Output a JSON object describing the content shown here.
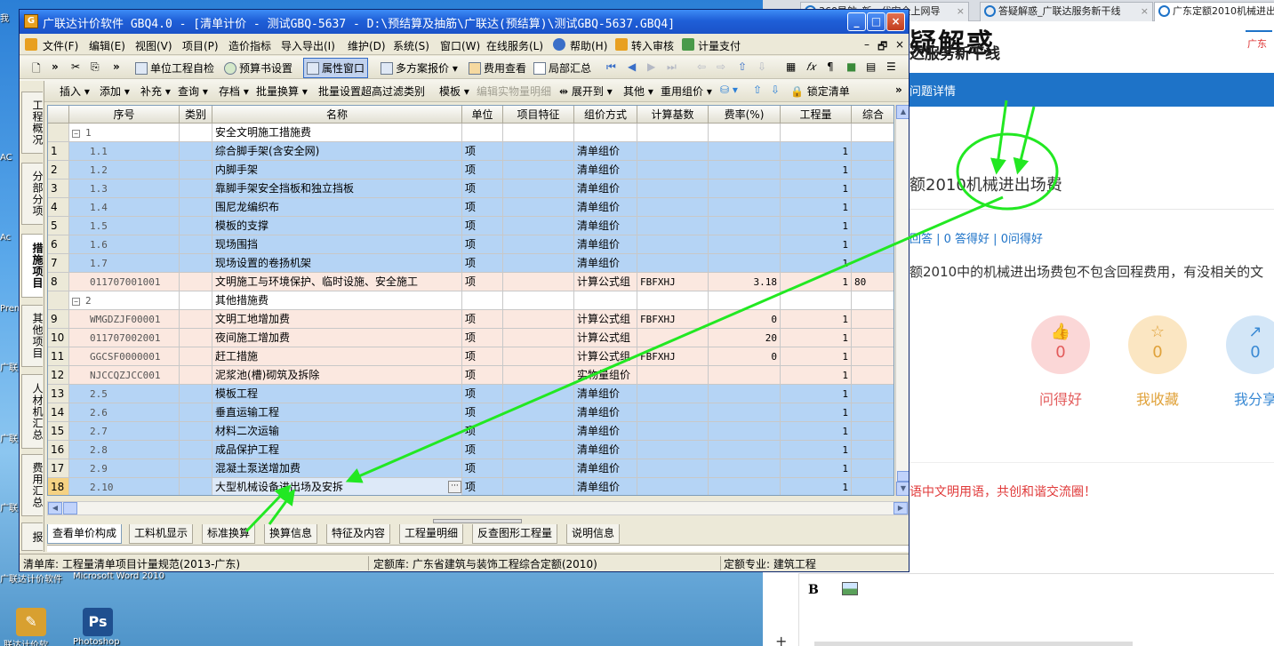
{
  "window": {
    "title": "广联达计价软件 GBQ4.0 - [清单计价 - 测试GBQ-5637 - D:\\预结算及抽筋\\广联达(预结算)\\测试GBQ-5637.GBQ4]",
    "minimize": "_",
    "maximize": "□",
    "close": "×"
  },
  "menu": {
    "items": [
      "文件(F)",
      "编辑(E)",
      "视图(V)",
      "项目(P)",
      "造价指标",
      "导入导出(I)",
      "维护(D)",
      "系统(S)",
      "窗口(W)",
      "在线服务(L)",
      "帮助(H)",
      "转入审核",
      "计量支付"
    ],
    "doc_controls": [
      "–",
      "🗗",
      "×"
    ]
  },
  "toolbar1": {
    "items": [
      "单位工程自检",
      "预算书设置",
      "属性窗口",
      "多方案报价 ▾",
      "费用查看",
      "局部汇总"
    ]
  },
  "toolbar2": {
    "items": [
      "插入 ▾",
      "添加 ▾",
      "补充 ▾",
      "查询 ▾",
      "存档 ▾",
      "批量换算 ▾",
      "批量设置超高过滤类别",
      "模板 ▾",
      "编辑实物量明细",
      "展开到 ▾",
      "其他 ▾",
      "重用组价 ▾",
      "锁定清单"
    ]
  },
  "side_tabs": [
    "工程概况",
    "分部分项",
    "措施项目",
    "其他项目",
    "人材机汇总",
    "费用汇总",
    "报"
  ],
  "grid": {
    "columns": [
      "",
      "序号",
      "类别",
      "名称",
      "单位",
      "项目特征",
      "组价方式",
      "计算基数",
      "费率(%)",
      "工程量",
      "综合"
    ],
    "rows": [
      {
        "num": "",
        "code": "1",
        "cat": "",
        "name": "安全文明施工措施费",
        "unit": "",
        "feature": "",
        "method": "",
        "base": "",
        "rate": "",
        "qty": "",
        "total": "",
        "style": "white",
        "group": true
      },
      {
        "num": "1",
        "code": "1.1",
        "cat": "",
        "name": "综合脚手架(含安全网)",
        "unit": "项",
        "feature": "",
        "method": "清单组价",
        "base": "",
        "rate": "",
        "qty": "1",
        "total": "",
        "style": "blue"
      },
      {
        "num": "2",
        "code": "1.2",
        "cat": "",
        "name": "内脚手架",
        "unit": "项",
        "feature": "",
        "method": "清单组价",
        "base": "",
        "rate": "",
        "qty": "1",
        "total": "",
        "style": "blue"
      },
      {
        "num": "3",
        "code": "1.3",
        "cat": "",
        "name": "靠脚手架安全挡板和独立挡板",
        "unit": "项",
        "feature": "",
        "method": "清单组价",
        "base": "",
        "rate": "",
        "qty": "1",
        "total": "",
        "style": "blue"
      },
      {
        "num": "4",
        "code": "1.4",
        "cat": "",
        "name": "围尼龙编织布",
        "unit": "项",
        "feature": "",
        "method": "清单组价",
        "base": "",
        "rate": "",
        "qty": "1",
        "total": "",
        "style": "blue"
      },
      {
        "num": "5",
        "code": "1.5",
        "cat": "",
        "name": "模板的支撑",
        "unit": "项",
        "feature": "",
        "method": "清单组价",
        "base": "",
        "rate": "",
        "qty": "1",
        "total": "",
        "style": "blue"
      },
      {
        "num": "6",
        "code": "1.6",
        "cat": "",
        "name": "现场围挡",
        "unit": "项",
        "feature": "",
        "method": "清单组价",
        "base": "",
        "rate": "",
        "qty": "1",
        "total": "",
        "style": "blue"
      },
      {
        "num": "7",
        "code": "1.7",
        "cat": "",
        "name": "现场设置的卷扬机架",
        "unit": "项",
        "feature": "",
        "method": "清单组价",
        "base": "",
        "rate": "",
        "qty": "1",
        "total": "",
        "style": "blue"
      },
      {
        "num": "8",
        "code": "011707001001",
        "cat": "",
        "name": "文明施工与环境保护、临时设施、安全施工",
        "unit": "项",
        "feature": "",
        "method": "计算公式组",
        "base": "FBFXHJ",
        "rate": "3.18",
        "qty": "1",
        "total": "80",
        "style": "pink"
      },
      {
        "num": "",
        "code": "2",
        "cat": "",
        "name": "其他措施费",
        "unit": "",
        "feature": "",
        "method": "",
        "base": "",
        "rate": "",
        "qty": "",
        "total": "",
        "style": "white",
        "group": true
      },
      {
        "num": "9",
        "code": "WMGDZJF00001",
        "cat": "",
        "name": "文明工地增加费",
        "unit": "项",
        "feature": "",
        "method": "计算公式组",
        "base": "FBFXHJ",
        "rate": "0",
        "qty": "1",
        "total": "",
        "style": "pink"
      },
      {
        "num": "10",
        "code": "011707002001",
        "cat": "",
        "name": "夜间施工增加费",
        "unit": "项",
        "feature": "",
        "method": "计算公式组",
        "base": "",
        "rate": "20",
        "qty": "1",
        "total": "",
        "style": "pink"
      },
      {
        "num": "11",
        "code": "GGCSF0000001",
        "cat": "",
        "name": "赶工措施",
        "unit": "项",
        "feature": "",
        "method": "计算公式组",
        "base": "FBFXHJ",
        "rate": "0",
        "qty": "1",
        "total": "",
        "style": "pink"
      },
      {
        "num": "12",
        "code": "NJCCQZJCC001",
        "cat": "",
        "name": "泥浆池(槽)砌筑及拆除",
        "unit": "项",
        "feature": "",
        "method": "实物量组价",
        "base": "",
        "rate": "",
        "qty": "1",
        "total": "",
        "style": "pink"
      },
      {
        "num": "13",
        "code": "2.5",
        "cat": "",
        "name": "模板工程",
        "unit": "项",
        "feature": "",
        "method": "清单组价",
        "base": "",
        "rate": "",
        "qty": "1",
        "total": "",
        "style": "blue"
      },
      {
        "num": "14",
        "code": "2.6",
        "cat": "",
        "name": "垂直运输工程",
        "unit": "项",
        "feature": "",
        "method": "清单组价",
        "base": "",
        "rate": "",
        "qty": "1",
        "total": "",
        "style": "blue"
      },
      {
        "num": "15",
        "code": "2.7",
        "cat": "",
        "name": "材料二次运输",
        "unit": "项",
        "feature": "",
        "method": "清单组价",
        "base": "",
        "rate": "",
        "qty": "1",
        "total": "",
        "style": "blue"
      },
      {
        "num": "16",
        "code": "2.8",
        "cat": "",
        "name": "成品保护工程",
        "unit": "项",
        "feature": "",
        "method": "清单组价",
        "base": "",
        "rate": "",
        "qty": "1",
        "total": "",
        "style": "blue"
      },
      {
        "num": "17",
        "code": "2.9",
        "cat": "",
        "name": "混凝土泵送增加费",
        "unit": "项",
        "feature": "",
        "method": "清单组价",
        "base": "",
        "rate": "",
        "qty": "1",
        "total": "",
        "style": "blue"
      },
      {
        "num": "18",
        "code": "2.10",
        "cat": "",
        "name": "大型机械设备进出场及安拆",
        "unit": "项",
        "feature": "",
        "method": "清单组价",
        "base": "",
        "rate": "",
        "qty": "1",
        "total": "",
        "style": "blue",
        "selected": true
      }
    ]
  },
  "bottom_tabs": [
    "查看单价构成",
    "工料机显示",
    "标准换算",
    "换算信息",
    "特征及内容",
    "工程量明细",
    "反查图形工程量",
    "说明信息"
  ],
  "status": {
    "list_lib": "清单库: 工程量清单项目计量规范(2013-广东)",
    "quota_lib": "定额库: 广东省建筑与装饰工程综合定额(2010)",
    "quota_major": "定额专业: 建筑工程"
  },
  "browser": {
    "tabs": [
      "360导航_新一代安全上网导",
      "答疑解惑_广联达服务新干线",
      "广东定额2010机械进出"
    ],
    "logo": "疑解惑",
    "slogan": "达服务新干线",
    "right_text": "广东",
    "nav_text": "问题详情",
    "question_title": "额2010机械进出场费",
    "stats": "回答 | 0 答得好 | 0问得好",
    "body": "额2010中的机械进出场费包不包含回程费用，有没相关的文",
    "actions": [
      {
        "label": "问得好",
        "count": "0",
        "icon": "👍"
      },
      {
        "label": "我收藏",
        "count": "0",
        "icon": "☆"
      },
      {
        "label": "我分享",
        "count": "0",
        "icon": "↗"
      }
    ],
    "notice": "语中文明用语，共创和谐交流圈！",
    "editor_bold": "B",
    "editor_plus": "+"
  },
  "desktop": {
    "labels": [
      "我",
      "AC",
      "Ac",
      "Prem",
      "广联\n装饰",
      "广联\n筋翻",
      "广联\n建筑"
    ],
    "icons": [
      {
        "caption": "广联达计价软件",
        "caption2": "联达计价软",
        "icon": "✎",
        "color": "#d8a030"
      },
      {
        "caption": "Microsoft Word 2010",
        "caption2": "Photoshop",
        "icon": "Ps",
        "color": "#1f4f8f"
      }
    ],
    "text1": "广联达钢筋翻\n工翻样 GF...",
    "text2": "Microsoft\nWord 2010"
  },
  "colors": {
    "row_blue": "#b5d4f5",
    "row_pink": "#fbe8e0",
    "annotation": "#22e822",
    "titlebar": "#1f5fd8"
  }
}
